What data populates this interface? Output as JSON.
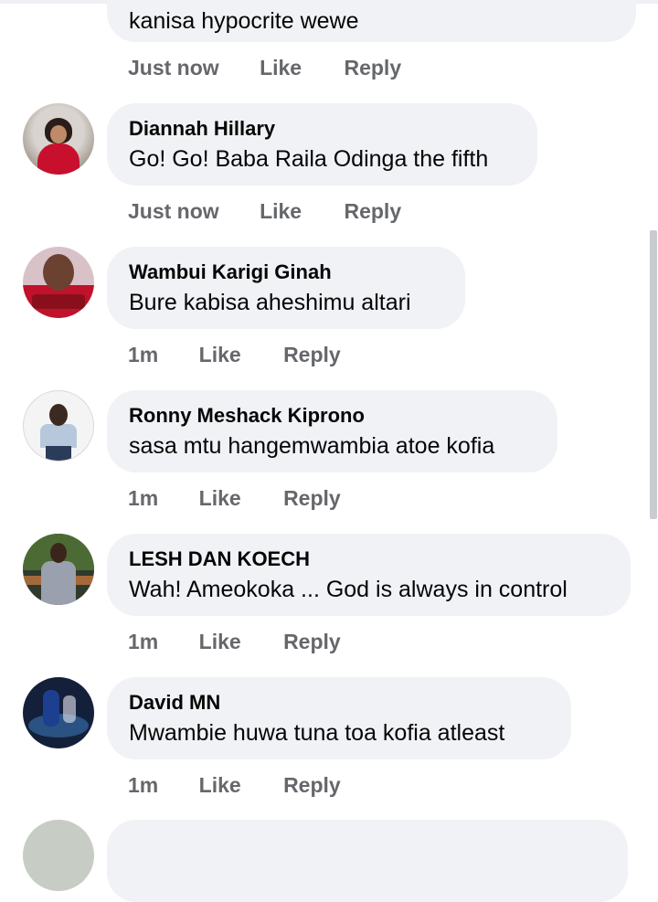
{
  "top_comment": {
    "text": "kanisa hypocrite wewe",
    "time": "Just now",
    "like": "Like",
    "reply": "Reply"
  },
  "comments": [
    {
      "name": "Diannah Hillary",
      "text": "Go! Go! Baba Raila Odinga the fifth",
      "time": "Just now",
      "like": "Like",
      "reply": "Reply"
    },
    {
      "name": "Wambui Karigi Ginah",
      "text": "Bure kabisa aheshimu altari",
      "time": "1m",
      "like": "Like",
      "reply": "Reply"
    },
    {
      "name": "Ronny Meshack Kiprono",
      "text": "sasa mtu hangemwambia atoe kofia",
      "time": "1m",
      "like": "Like",
      "reply": "Reply"
    },
    {
      "name": "LESH DAN KOECH",
      "text": "Wah! Ameokoka ... God is always in control",
      "time": "1m",
      "like": "Like",
      "reply": "Reply"
    },
    {
      "name": "David MN",
      "text": "Mwambie huwa tuna toa kofia atleast",
      "time": "1m",
      "like": "Like",
      "reply": "Reply"
    }
  ]
}
